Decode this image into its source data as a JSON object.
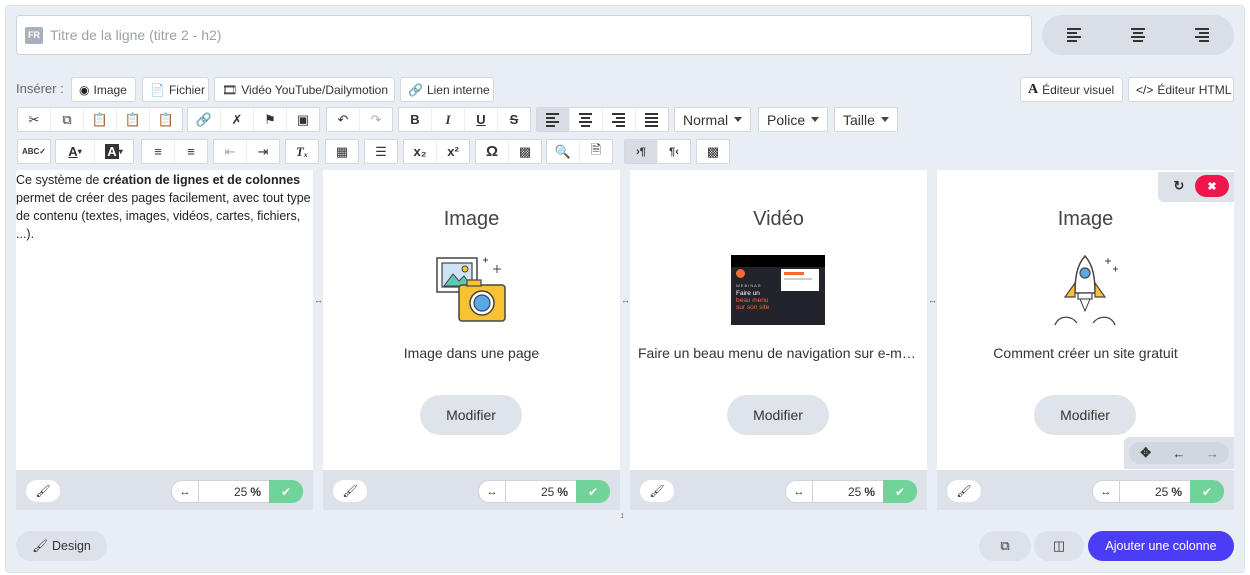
{
  "title": {
    "lang_badge": "FR",
    "placeholder": "Titre de la ligne (titre 2 - h2)"
  },
  "insert": {
    "label": "Insérer :",
    "buttons": [
      {
        "icon": "camera-icon",
        "label": "Image"
      },
      {
        "icon": "file-icon",
        "label": "Fichier"
      },
      {
        "icon": "film-icon",
        "label": "Vidéo YouTube/Dailymotion"
      },
      {
        "icon": "link-icon",
        "label": "Lien interne"
      }
    ],
    "visual_editor": "Éditeur visuel",
    "html_editor": "Éditeur HTML"
  },
  "toolbar": {
    "format_select": "Normal",
    "font_select": "Police",
    "size_select": "Taille"
  },
  "text_column": {
    "intro": "Ce système de ",
    "bold": "création de lignes et de colonnes",
    "rest": " permet de créer des pages facilement, avec tout type de contenu (textes, images, vidéos, cartes, fichiers, ...)."
  },
  "columns": [
    {
      "title": "Image",
      "caption": "Image dans une page",
      "modify": "Modifier"
    },
    {
      "title": "Vidéo",
      "caption": "Faire un beau menu de navigation sur e-monsite",
      "modify": "Modifier",
      "video": {
        "tag": "WEBINAR",
        "line1": "Faire un",
        "line2": "beau menu",
        "line3": "sur son site"
      }
    },
    {
      "title": "Image",
      "caption": "Comment créer un site gratuit",
      "modify": "Modifier"
    }
  ],
  "column_width": {
    "value": "25",
    "unit": "%"
  },
  "bottom": {
    "design": "Design",
    "add_column": "Ajouter une colonne"
  },
  "colors": {
    "accent": "#4a3df5",
    "ok": "#6fd39a",
    "danger": "#f0164c",
    "bg": "#e9edf4"
  }
}
